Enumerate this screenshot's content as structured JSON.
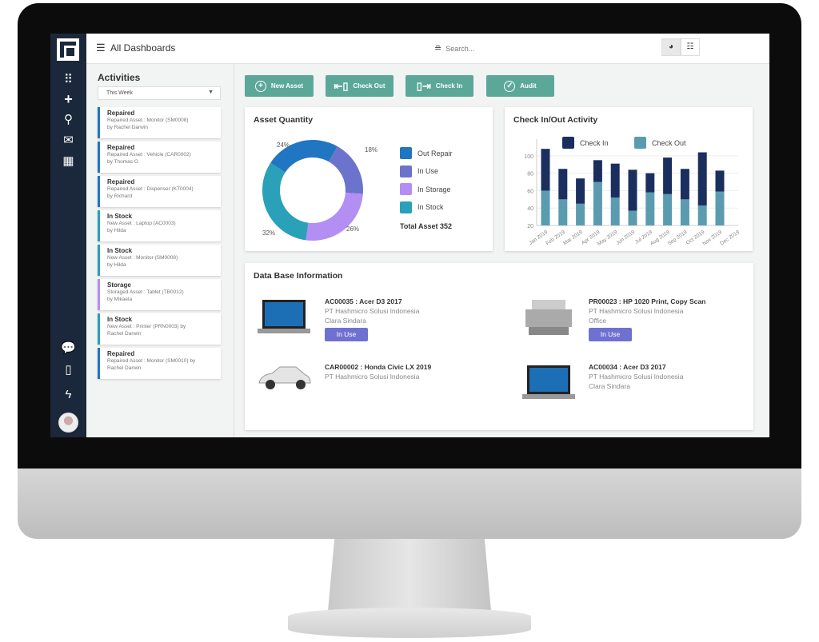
{
  "header": {
    "title": "All Dashboards",
    "search_placeholder": "Search..."
  },
  "sidebar": {
    "icons": [
      "apps-icon",
      "plus-icon",
      "search-icon",
      "mail-icon",
      "calendar-icon",
      "chat-icon",
      "building-icon",
      "bolt-icon"
    ]
  },
  "activities": {
    "title": "Activities",
    "filter": "This Week",
    "items": [
      {
        "status": "Repaired",
        "line1": "Repaired Asset : Monitor (SM0008)",
        "line2": "by Rachel Darwin",
        "color": "#2176c2"
      },
      {
        "status": "Repaired",
        "line1": "Repaired Asset : Vehicle (CAR0002)",
        "line2": "by Thomas G",
        "color": "#2176c2"
      },
      {
        "status": "Repaired",
        "line1": "Repaired Asset : Dispenser (KT0004)",
        "line2": "by Richard",
        "color": "#2176c2"
      },
      {
        "status": "In Stock",
        "line1": "New Asset : Laptop (AC0003)",
        "line2": "by Hilda",
        "color": "#2aa0b9"
      },
      {
        "status": "In Stock",
        "line1": "New Asset : Monitor (SM0008)",
        "line2": "by Hilda",
        "color": "#2aa0b9"
      },
      {
        "status": "Storage",
        "line1": "Storaged Asset : Tablet (TB0012)",
        "line2": "by Mikaela",
        "color": "#b38ef3"
      },
      {
        "status": "In Stock",
        "line1": "New Asset : Printer (PRN0003) by",
        "line2": "Rachel Darwin",
        "color": "#2aa0b9"
      },
      {
        "status": "Repaired",
        "line1": "Repaired Asset : Monitor (SM0010) by",
        "line2": "Rachel Darwin",
        "color": "#2176c2"
      }
    ]
  },
  "actions": [
    {
      "label": "New Asset",
      "icon": "plus-circle-icon"
    },
    {
      "label": "Check Out",
      "icon": "check-out-icon"
    },
    {
      "label": "Check In",
      "icon": "check-in-icon"
    },
    {
      "label": "Audit",
      "icon": "check-circle-icon"
    }
  ],
  "chart_data": [
    {
      "type": "pie",
      "title": "Asset Quantity",
      "donut": true,
      "categories": [
        "Out Repair",
        "In Use",
        "In Storage",
        "In Stock"
      ],
      "values": [
        24,
        18,
        26,
        32
      ],
      "labels": [
        "24%",
        "18%",
        "26%",
        "32%"
      ],
      "colors": [
        "#2176c2",
        "#6b73cc",
        "#b38ef3",
        "#2aa0b9"
      ],
      "legend": "right",
      "total_label": "Total Asset 352"
    },
    {
      "type": "bar",
      "stacked": true,
      "title": "Check In/Out Activity",
      "categories": [
        "Jan 2019",
        "Feb 2019",
        "Mar 2019",
        "Apr 2019",
        "May 2019",
        "Jun 2019",
        "Jul 2019",
        "Aug 2019",
        "Sep 2019",
        "Oct 2019",
        "Nov 2019",
        "Dec 2019"
      ],
      "series": [
        {
          "name": "Check Out",
          "values": [
            60,
            50,
            45,
            70,
            52,
            37,
            58,
            56,
            50,
            43,
            59,
            null
          ],
          "color": "#5b9bb0"
        },
        {
          "name": "Check In",
          "values": [
            48,
            35,
            29,
            25,
            39,
            47,
            22,
            42,
            35,
            61,
            24,
            null
          ],
          "color": "#1b2f5e"
        }
      ],
      "ylim": [
        20,
        110
      ],
      "yticks": [
        20,
        40,
        60,
        80,
        100
      ],
      "grid": true,
      "legend": "top"
    }
  ],
  "database": {
    "title": "Data Base Information",
    "items": [
      {
        "title": "AC00035 : Acer D3 2017",
        "line1": "PT Hashmicro Solusi Indonesia",
        "line2": "Clara Sindara",
        "badge": "In Use",
        "image": "laptop"
      },
      {
        "title": "PR00023 : HP 1020 Print, Copy Scan",
        "line1": "PT Hashmicro Solusi Indonesia",
        "line2": "Office",
        "badge": "In Use",
        "image": "printer"
      },
      {
        "title": "CAR00002 : Honda Civic LX 2019",
        "line1": "PT Hashmicro Solusi Indonesia",
        "image": "car"
      },
      {
        "title": "AC00034 : Acer D3 2017",
        "line1": "PT Hashmicro Solusi Indonesia",
        "line2": "Clara Sindara",
        "image": "laptop"
      }
    ]
  }
}
